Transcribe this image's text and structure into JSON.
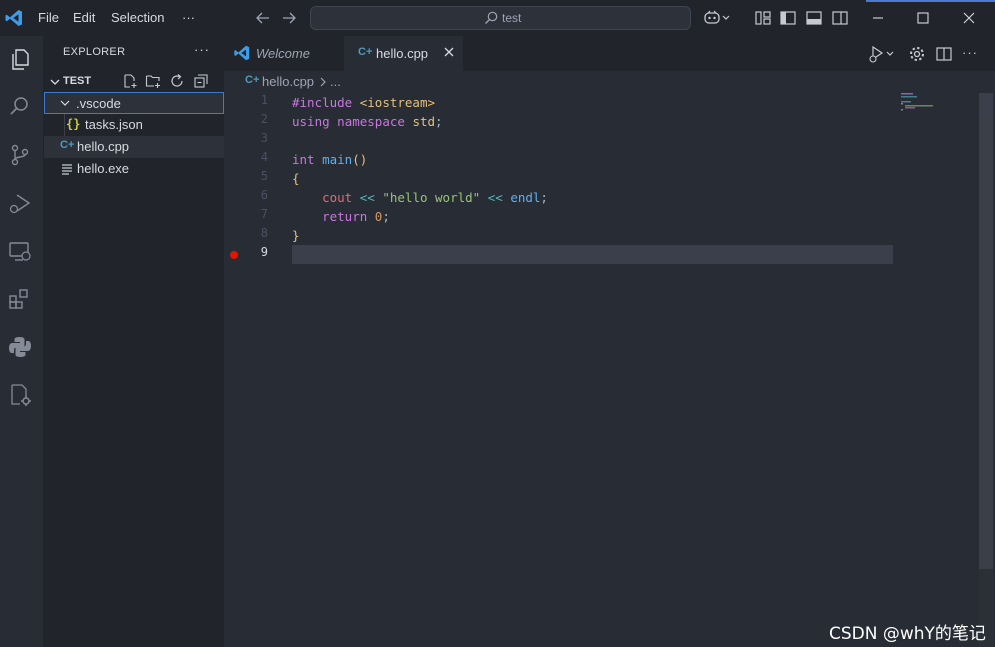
{
  "titlebar": {
    "menu": [
      "File",
      "Edit",
      "Selection",
      "···"
    ],
    "search_text": "test"
  },
  "sidebar": {
    "title": "EXPLORER",
    "more": "···",
    "section_label": "TEST",
    "tree": [
      {
        "label": ".vscode",
        "type": "folder"
      },
      {
        "label": "tasks.json",
        "type": "json"
      },
      {
        "label": "hello.cpp",
        "type": "cpp"
      },
      {
        "label": "hello.exe",
        "type": "exe"
      }
    ]
  },
  "tabs": [
    {
      "label": "Welcome"
    },
    {
      "label": "hello.cpp"
    }
  ],
  "breadcrumb": {
    "file": "hello.cpp",
    "more": "..."
  },
  "editor": {
    "line_numbers": [
      "1",
      "2",
      "3",
      "4",
      "5",
      "6",
      "7",
      "8",
      "9"
    ],
    "current_line": "9",
    "breakpoint_line": "9"
  },
  "watermark": "CSDN @whY的笔记",
  "colors": {
    "accent": "#4d78cc",
    "breakpoint": "#e51400",
    "editor_bg": "#282c34",
    "sidebar_bg": "#21252b"
  }
}
